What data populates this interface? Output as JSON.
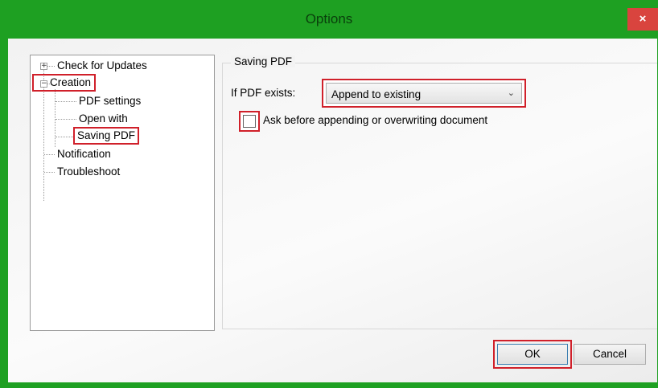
{
  "window": {
    "title": "Options",
    "close_glyph": "×"
  },
  "tree": {
    "items": [
      {
        "label": "Check for Updates",
        "expander": "+"
      },
      {
        "label": "Creation",
        "expander": "−"
      },
      {
        "label": "PDF settings"
      },
      {
        "label": "Open with"
      },
      {
        "label": "Saving PDF"
      },
      {
        "label": "Notification"
      },
      {
        "label": "Troubleshoot"
      }
    ]
  },
  "panel": {
    "group_title": "Saving PDF",
    "if_exists_label": "If PDF exists:",
    "if_exists_value": "Append to existing",
    "ask_checkbox_label": "Ask before appending or overwriting document",
    "ask_checkbox_checked": false
  },
  "buttons": {
    "ok": "OK",
    "cancel": "Cancel"
  },
  "colors": {
    "titlebar": "#1ea022",
    "highlight": "#d0202a",
    "close": "#d9443e"
  }
}
